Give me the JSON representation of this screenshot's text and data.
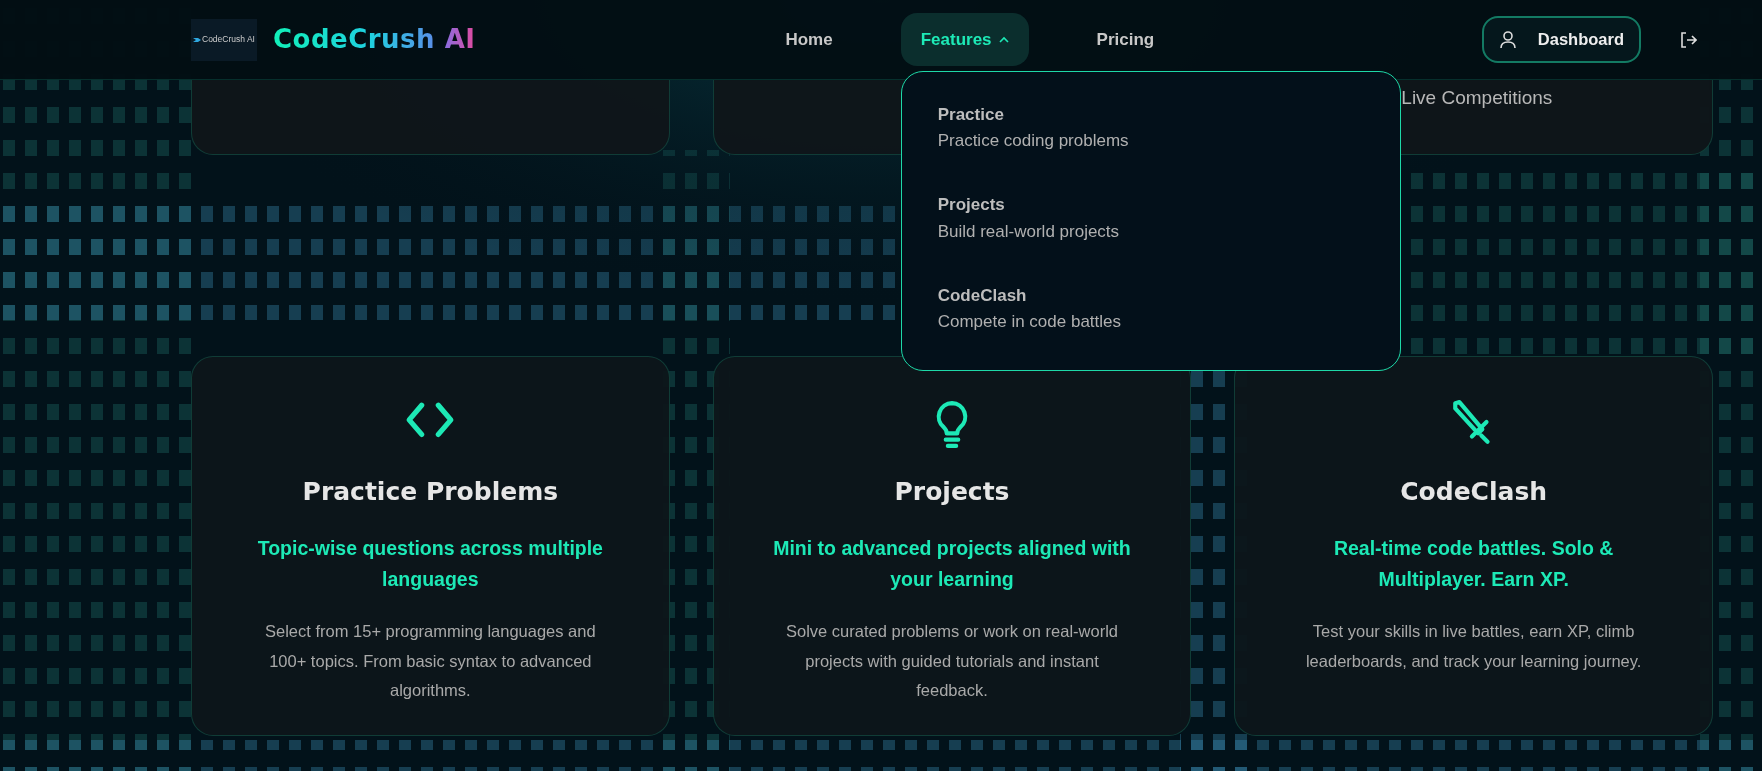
{
  "brand": {
    "logo_text": "CodeCrush AI",
    "name": "CodeCrush",
    "name_suffix": "AI"
  },
  "nav": [
    {
      "label": "Home",
      "kind": "link",
      "selected": false
    },
    {
      "label": "Features",
      "kind": "dropdown",
      "selected": true,
      "expanded": true
    },
    {
      "label": "Pricing",
      "kind": "link",
      "selected": false
    }
  ],
  "features_menu": [
    {
      "title": "Practice",
      "description": "Practice coding problems"
    },
    {
      "title": "Projects",
      "description": "Build real-world projects"
    },
    {
      "title": "CodeClash",
      "description": "Compete in code battles"
    }
  ],
  "dashboard_button": {
    "label": "Dashboard"
  },
  "top_cards": [
    {
      "kind": "blank"
    },
    {
      "kind": "blank"
    },
    {
      "kind": "text",
      "text": "Live Competitions"
    }
  ],
  "cards": [
    {
      "title": "Practice Problems",
      "subtitle": "Topic-wise questions across multiple languages",
      "description": "Select from 15+ programming languages and 100+ topics. From basic syntax to advanced algorithms."
    },
    {
      "title": "Projects",
      "subtitle": "Mini to advanced projects aligned with your learning",
      "description": "Solve curated problems or work on real-world projects with guided tutorials and instant feedback."
    },
    {
      "title": "CodeClash",
      "subtitle": "Real-time code battles. Solo & Multiplayer. Earn XP.",
      "description": "Test your skills in live battles, earn XP, climb leaderboards, and track your learning journey."
    }
  ]
}
